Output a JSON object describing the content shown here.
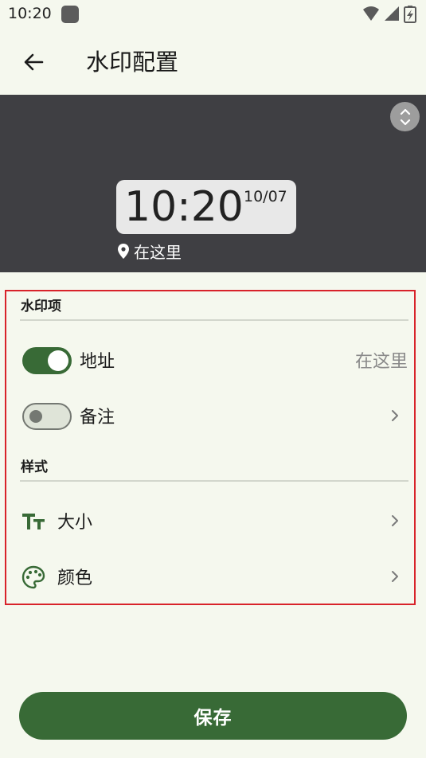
{
  "status_bar": {
    "time": "10:20",
    "icons": [
      "wifi-icon",
      "cellular-signal-icon",
      "battery-icon"
    ]
  },
  "app_bar": {
    "back_icon": "arrow-left-icon",
    "title": "水印配置"
  },
  "preview": {
    "time": "10:20",
    "date": "10/07",
    "location": "在这里",
    "expand_icon": "chevron-up-down-icon"
  },
  "sections": {
    "items_header": "水印项",
    "style_header": "样式"
  },
  "items": {
    "address": {
      "label": "地址",
      "value": "在这里",
      "enabled": true
    },
    "note": {
      "label": "备注",
      "enabled": false
    }
  },
  "style": {
    "size": {
      "label": "大小",
      "icon": "text-size-icon"
    },
    "color": {
      "label": "颜色",
      "icon": "palette-icon"
    }
  },
  "actions": {
    "save_label": "保存"
  },
  "colors": {
    "background": "#f5f8ee",
    "primary": "#386a36",
    "preview_bg": "#3f3f43",
    "highlight_border": "#d8232a"
  }
}
